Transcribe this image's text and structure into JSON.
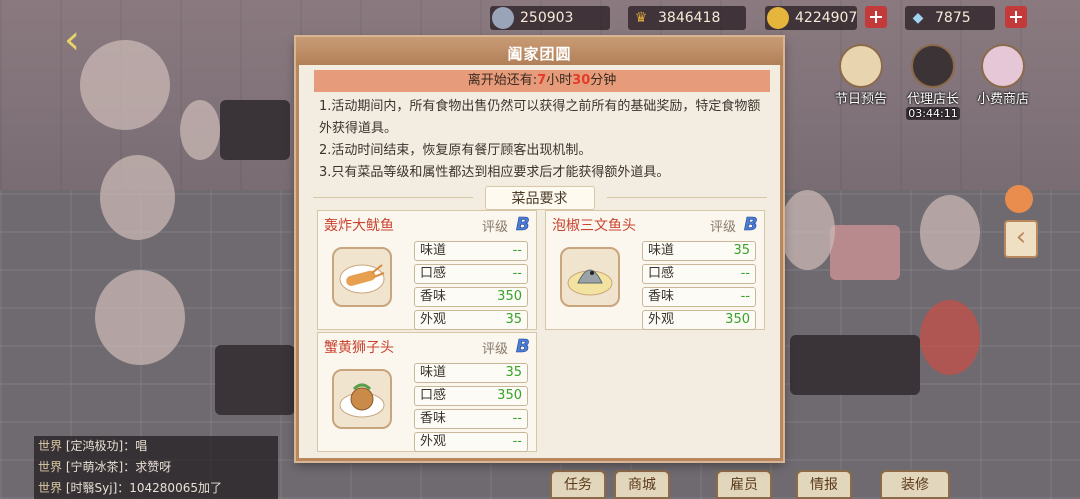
{
  "resources": [
    {
      "name": "silver-coin",
      "value": "250903",
      "color": "#9aa4b8"
    },
    {
      "name": "crown",
      "value": "3846418",
      "color": "#e0a93a"
    },
    {
      "name": "gold-coin",
      "value": "4224907",
      "color": "#e6b53c"
    },
    {
      "name": "diamond",
      "value": "7875",
      "color": "#9fd3f0"
    }
  ],
  "right_menu": {
    "festival_label": "节日预告",
    "manager_label": "代理店长",
    "manager_timer": "03:44:11",
    "shop_label": "小费商店"
  },
  "panel": {
    "title": "阖家团圆",
    "countdown": {
      "prefix": "离开始还有:",
      "hours": "7",
      "hour_unit": "小时",
      "minutes": "30",
      "minute_unit": "分钟"
    },
    "rules": [
      "1.活动期间内，所有食物出售仍然可以获得之前所有的基础奖励，特定食物额外获得道具。",
      "2.活动时间结束，恢复原有餐厅顾客出现机制。",
      "3.只有菜品等级和属性都达到相应要求后才能获得额外道具。"
    ],
    "section_title": "菜品要求",
    "grade_label": "评级",
    "dishes": [
      {
        "name": "轰炸大鱿鱼",
        "grade": "B",
        "attrs": [
          {
            "k": "味道",
            "v": "--"
          },
          {
            "k": "口感",
            "v": "--"
          },
          {
            "k": "香味",
            "v": "350"
          },
          {
            "k": "外观",
            "v": "35"
          }
        ]
      },
      {
        "name": "泡椒三文鱼头",
        "grade": "B",
        "attrs": [
          {
            "k": "味道",
            "v": "35"
          },
          {
            "k": "口感",
            "v": "--"
          },
          {
            "k": "香味",
            "v": "--"
          },
          {
            "k": "外观",
            "v": "350"
          }
        ]
      },
      {
        "name": "蟹黄狮子头",
        "grade": "B",
        "attrs": [
          {
            "k": "味道",
            "v": "35"
          },
          {
            "k": "口感",
            "v": "350"
          },
          {
            "k": "香味",
            "v": "--"
          },
          {
            "k": "外观",
            "v": "--"
          }
        ]
      }
    ]
  },
  "chat": [
    {
      "channel": "世界",
      "text": "[定鸿极功]：唱"
    },
    {
      "channel": "世界",
      "text": "[宁萌冰茶]：求赞呀"
    },
    {
      "channel": "世界",
      "text": "[时翳Syj]：104280065加了"
    }
  ],
  "bottom_buttons": [
    "任务",
    "商城",
    "雇员",
    "情报",
    "装修"
  ],
  "colors": {
    "accent": "#c9432f",
    "value_green": "#38a12a",
    "panel_border": "#b8875e",
    "countdown_bg": "#e69b7a"
  }
}
